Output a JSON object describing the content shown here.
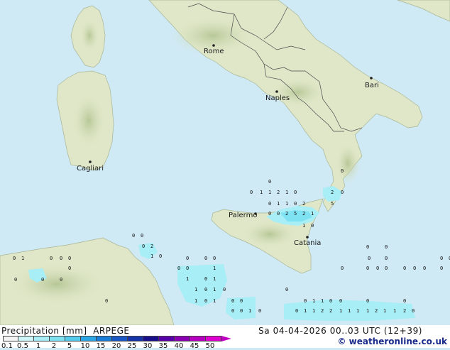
{
  "cities": [
    {
      "name": "Rome"
    },
    {
      "name": "Naples"
    },
    {
      "name": "Bari"
    },
    {
      "name": "Cagliari"
    },
    {
      "name": "Palermo"
    },
    {
      "name": "Catania"
    }
  ],
  "legend": {
    "title": "Precipitation [mm]",
    "model": "ARPEGE",
    "labels": [
      "0.1",
      "0.5",
      "1",
      "2",
      "5",
      "10",
      "15",
      "20",
      "25",
      "30",
      "35",
      "40",
      "45",
      "50"
    ],
    "colors": [
      "#f4f4f4",
      "#cff6f8",
      "#a8eef6",
      "#7fe2f2",
      "#55cbee",
      "#2da6e6",
      "#1a7ed8",
      "#1957c4",
      "#1733a8",
      "#190f8a",
      "#5a00a8",
      "#8c00b4",
      "#b800c0",
      "#e000d0"
    ]
  },
  "timestamp": "Sa 04-04-2026 00..03 UTC (12+39)",
  "credit": "© weatheronline.co.uk",
  "colors": {
    "sea": "#cfe9f5",
    "land": "#dfe7c8",
    "highland": "#c7d4a8",
    "precip_light": "#a8eef6",
    "precip_mid": "#6fd8f0"
  }
}
